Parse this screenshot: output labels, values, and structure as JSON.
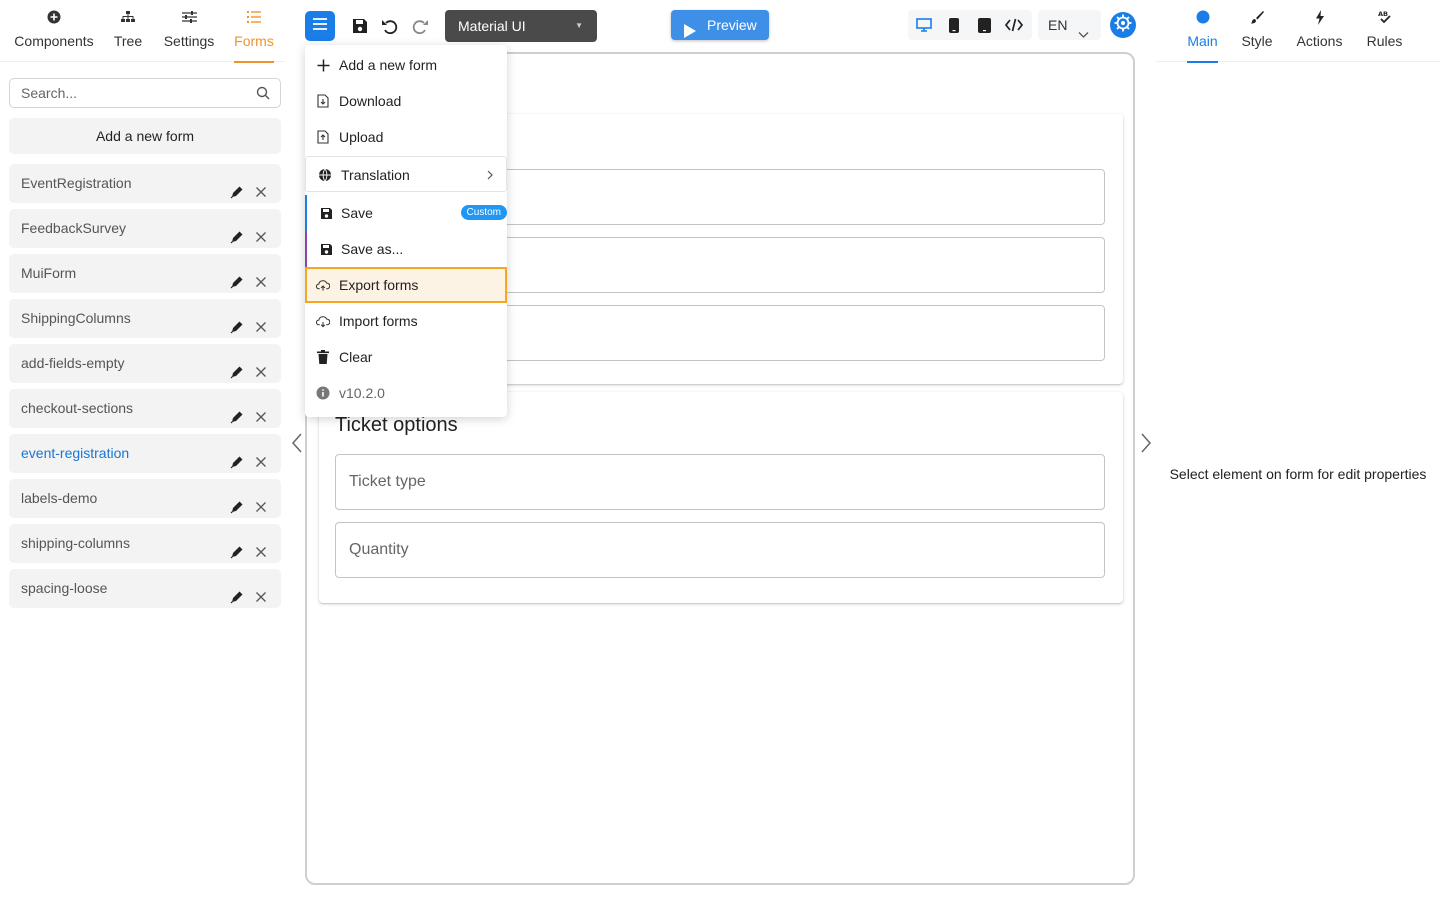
{
  "left_tabs": [
    {
      "label": "Components",
      "icon": "plus-circle-icon"
    },
    {
      "label": "Tree",
      "icon": "tree-icon"
    },
    {
      "label": "Settings",
      "icon": "sliders-icon"
    },
    {
      "label": "Forms",
      "icon": "list-icon"
    }
  ],
  "active_left_tab": "Forms",
  "search": {
    "placeholder": "Search..."
  },
  "add_form_label": "Add a new form",
  "forms": [
    {
      "name": "EventRegistration"
    },
    {
      "name": "FeedbackSurvey"
    },
    {
      "name": "MuiForm"
    },
    {
      "name": "ShippingColumns"
    },
    {
      "name": "add-fields-empty"
    },
    {
      "name": "checkout-sections"
    },
    {
      "name": "event-registration"
    },
    {
      "name": "labels-demo"
    },
    {
      "name": "shipping-columns"
    },
    {
      "name": "spacing-loose"
    }
  ],
  "active_form": "event-registration",
  "toolbar": {
    "theme": "Material UI",
    "preview_label": "Preview",
    "language": "EN"
  },
  "menu": {
    "items": [
      {
        "label": "Add a new form",
        "icon": "plus-icon"
      },
      {
        "label": "Download",
        "icon": "download-file-icon"
      },
      {
        "label": "Upload",
        "icon": "upload-file-icon"
      },
      {
        "label": "Translation",
        "icon": "globe-icon"
      },
      {
        "label": "Save",
        "icon": "save-icon",
        "badge": "Custom"
      },
      {
        "label": "Save as...",
        "icon": "save-icon"
      },
      {
        "label": "Export forms",
        "icon": "cloud-export-icon"
      },
      {
        "label": "Import forms",
        "icon": "cloud-import-icon"
      },
      {
        "label": "Clear",
        "icon": "trash-icon"
      },
      {
        "label": "v10.2.0",
        "icon": "info-icon"
      }
    ]
  },
  "form_preview": {
    "section2_title": "Ticket options",
    "fields_section2": [
      "Ticket type",
      "Quantity"
    ]
  },
  "right_tabs": [
    {
      "label": "Main",
      "icon": "circle-icon"
    },
    {
      "label": "Style",
      "icon": "brush-icon"
    },
    {
      "label": "Actions",
      "icon": "bolt-icon"
    },
    {
      "label": "Rules",
      "icon": "rules-icon"
    }
  ],
  "active_right_tab": "Main",
  "properties_message": "Select element on form for edit properties",
  "colors": {
    "accent_blue": "#1a7ee6",
    "forms_tab_orange": "#f0932b",
    "highlight_orange": "#f5a623",
    "save_bar_purple": "#8e44ad"
  }
}
